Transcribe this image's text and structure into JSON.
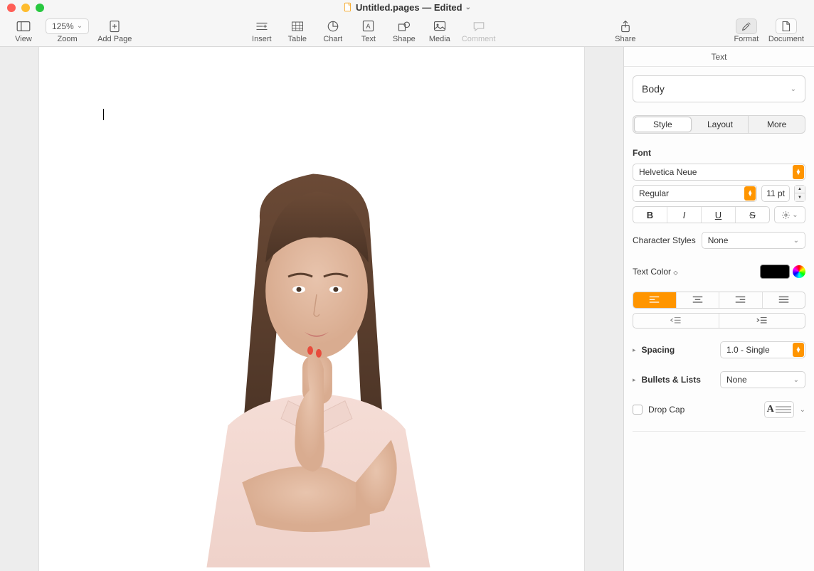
{
  "titlebar": {
    "doc_name": "Untitled.pages",
    "status": "Edited"
  },
  "toolbar": {
    "view": "View",
    "zoom": "Zoom",
    "zoom_value": "125%",
    "add_page": "Add Page",
    "insert": "Insert",
    "table": "Table",
    "chart": "Chart",
    "text": "Text",
    "shape": "Shape",
    "media": "Media",
    "comment": "Comment",
    "share": "Share",
    "format": "Format",
    "document": "Document"
  },
  "inspector": {
    "header": "Text",
    "paragraph_style": "Body",
    "tabs": {
      "style": "Style",
      "layout": "Layout",
      "more": "More"
    },
    "font": {
      "label": "Font",
      "family": "Helvetica Neue",
      "weight": "Regular",
      "size": "11 pt",
      "bold": "B",
      "italic": "I",
      "underline": "U",
      "strike": "S"
    },
    "char_styles": {
      "label": "Character Styles",
      "value": "None"
    },
    "text_color": {
      "label": "Text Color",
      "value": "#000000"
    },
    "spacing": {
      "label": "Spacing",
      "value": "1.0 - Single"
    },
    "bullets": {
      "label": "Bullets & Lists",
      "value": "None"
    },
    "dropcap": {
      "label": "Drop Cap"
    }
  }
}
